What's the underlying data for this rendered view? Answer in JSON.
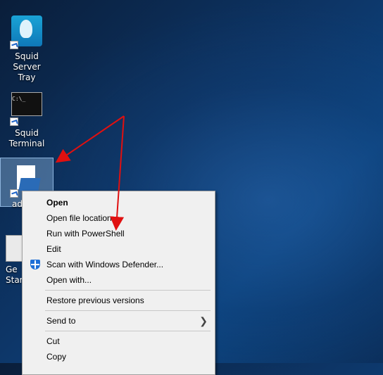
{
  "desktop": {
    "icons": [
      {
        "label_line1": "Squid Server",
        "label_line2": "Tray"
      },
      {
        "label_line1": "Squid",
        "label_line2": "Terminal"
      },
      {
        "label_line1": "ad",
        "label_line2": ""
      },
      {
        "label_line1": "Ge",
        "label_line2": "Star"
      }
    ],
    "terminal_icon_text": "C:\\_"
  },
  "context_menu": {
    "items": [
      {
        "label": "Open"
      },
      {
        "label": "Open file location"
      },
      {
        "label": "Run with PowerShell"
      },
      {
        "label": "Edit"
      },
      {
        "label": "Scan with Windows Defender..."
      },
      {
        "label": "Open with..."
      },
      {
        "label": "Restore previous versions"
      },
      {
        "label": "Send to"
      },
      {
        "label": "Cut"
      },
      {
        "label": "Copy"
      }
    ]
  },
  "colors": {
    "annotation_arrow": "#e01010",
    "defender_blue": "#1e6fd6"
  }
}
